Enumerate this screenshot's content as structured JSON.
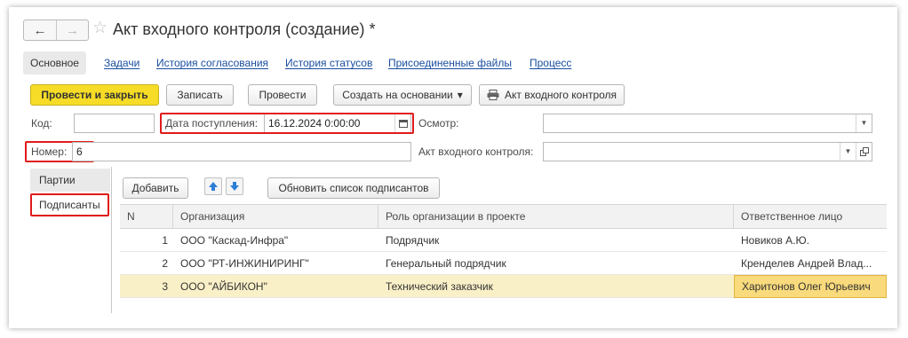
{
  "header": {
    "back": "←",
    "forward": "→",
    "star": "☆",
    "title": "Акт входного контроля (создание) *"
  },
  "sections": {
    "active": "Основное",
    "links": [
      "Задачи",
      "История согласования",
      "История статусов",
      "Присоединенные файлы",
      "Процесс"
    ]
  },
  "toolbar": {
    "post_close": "Провести и закрыть",
    "save": "Записать",
    "post": "Провести",
    "create_based": "Создать на основании",
    "dropdown_caret": "▾",
    "print_report": "Акт входного контроля"
  },
  "form": {
    "code_label": "Код:",
    "code_value": "",
    "date_label": "Дата поступления:",
    "date_value": "16.12.2024  0:00:00",
    "inspection_label": "Осмотр:",
    "inspection_value": "",
    "number_label": "Номер:",
    "number_value": "6",
    "act_label": "Акт входного контроля:",
    "act_value": ""
  },
  "tabs": [
    "Партии",
    "Подписанты"
  ],
  "table_toolbar": {
    "add": "Добавить",
    "refresh": "Обновить список подписантов"
  },
  "table": {
    "columns": [
      "N",
      "Организация",
      "Роль организации в проекте",
      "Ответственное лицо"
    ],
    "rows": [
      {
        "n": "1",
        "org": "ООО \"Каскад-Инфра\"",
        "role": "Подрядчик",
        "person": "Новиков А.Ю."
      },
      {
        "n": "2",
        "org": "ООО \"РТ-ИНЖИНИРИНГ\"",
        "role": "Генеральный подрядчик",
        "person": "Кренделев Андрей Влад..."
      },
      {
        "n": "3",
        "org": "ООО \"АЙБИКОН\"",
        "role": "Технический заказчик",
        "person": "Харитонов Олег Юрьевич"
      }
    ]
  },
  "colors": {
    "accent": "#f6dc26",
    "highlight_box": "#e01b1b",
    "link": "#1a4fa0",
    "selected_row": "#faf0c8"
  }
}
